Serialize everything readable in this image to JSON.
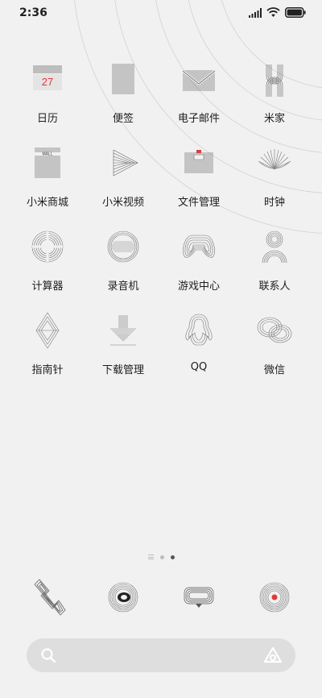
{
  "status_bar": {
    "time": "2:36",
    "icons": [
      "signal-icon",
      "wifi-icon",
      "battery-icon"
    ]
  },
  "apps": [
    {
      "label": "日历",
      "icon": "calendar-icon",
      "date": "27"
    },
    {
      "label": "便签",
      "icon": "notes-icon"
    },
    {
      "label": "电子邮件",
      "icon": "mail-icon"
    },
    {
      "label": "米家",
      "icon": "mijia-icon"
    },
    {
      "label": "小米商城",
      "icon": "mall-icon",
      "badge": "MALL"
    },
    {
      "label": "小米视频",
      "icon": "video-icon"
    },
    {
      "label": "文件管理",
      "icon": "file-manager-icon"
    },
    {
      "label": "时钟",
      "icon": "clock-icon"
    },
    {
      "label": "计算器",
      "icon": "calculator-icon"
    },
    {
      "label": "录音机",
      "icon": "recorder-icon"
    },
    {
      "label": "游戏中心",
      "icon": "game-center-icon"
    },
    {
      "label": "联系人",
      "icon": "contacts-icon"
    },
    {
      "label": "指南针",
      "icon": "compass-icon"
    },
    {
      "label": "下载管理",
      "icon": "download-icon"
    },
    {
      "label": "QQ",
      "icon": "qq-icon"
    },
    {
      "label": "微信",
      "icon": "wechat-icon"
    }
  ],
  "page_indicator": {
    "pages": 3,
    "current": 3
  },
  "dock": [
    {
      "icon": "phone-icon"
    },
    {
      "icon": "browser-icon"
    },
    {
      "icon": "messages-icon"
    },
    {
      "icon": "camera-icon"
    }
  ],
  "search": {
    "icon": "search-icon",
    "assistant_icon": "assistant-icon",
    "placeholder": ""
  },
  "colors": {
    "background": "#f1f1f1",
    "accent_red": "#e03a3a",
    "search_bg": "#dedede"
  }
}
